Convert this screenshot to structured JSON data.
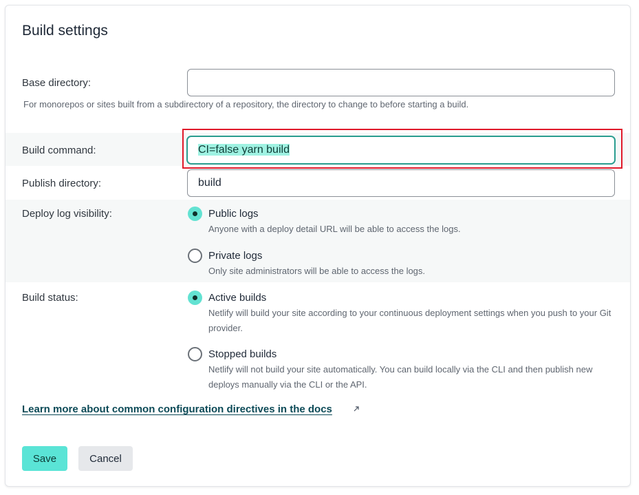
{
  "title": "Build settings",
  "base_directory": {
    "label": "Base directory:",
    "value": "",
    "help": "For monorepos or sites built from a subdirectory of a repository, the directory to change to before starting a build."
  },
  "build_command": {
    "label": "Build command:",
    "value": "CI=false yarn build"
  },
  "publish_directory": {
    "label": "Publish directory:",
    "value": "build"
  },
  "deploy_log": {
    "label": "Deploy log visibility:",
    "options": [
      {
        "title": "Public logs",
        "desc": "Anyone with a deploy detail URL will be able to access the logs.",
        "checked": true
      },
      {
        "title": "Private logs",
        "desc": "Only site administrators will be able to access the logs.",
        "checked": false
      }
    ]
  },
  "build_status": {
    "label": "Build status:",
    "options": [
      {
        "title": "Active builds",
        "desc": "Netlify will build your site according to your continuous deployment settings when you push to your Git provider.",
        "checked": true
      },
      {
        "title": "Stopped builds",
        "desc": "Netlify will not build your site automatically. You can build locally via the CLI and then publish new deploys manually via the CLI or the API.",
        "checked": false
      }
    ]
  },
  "docs_link": {
    "label": "Learn more about common configuration directives in the docs",
    "icon": "external-link-icon"
  },
  "buttons": {
    "save": "Save",
    "cancel": "Cancel"
  },
  "colors": {
    "accent": "#5ae4d6",
    "selection": "#9ff2e2",
    "focus_border": "#2a9d8f",
    "highlight_box": "#e0192a",
    "link": "#0c4a57"
  }
}
